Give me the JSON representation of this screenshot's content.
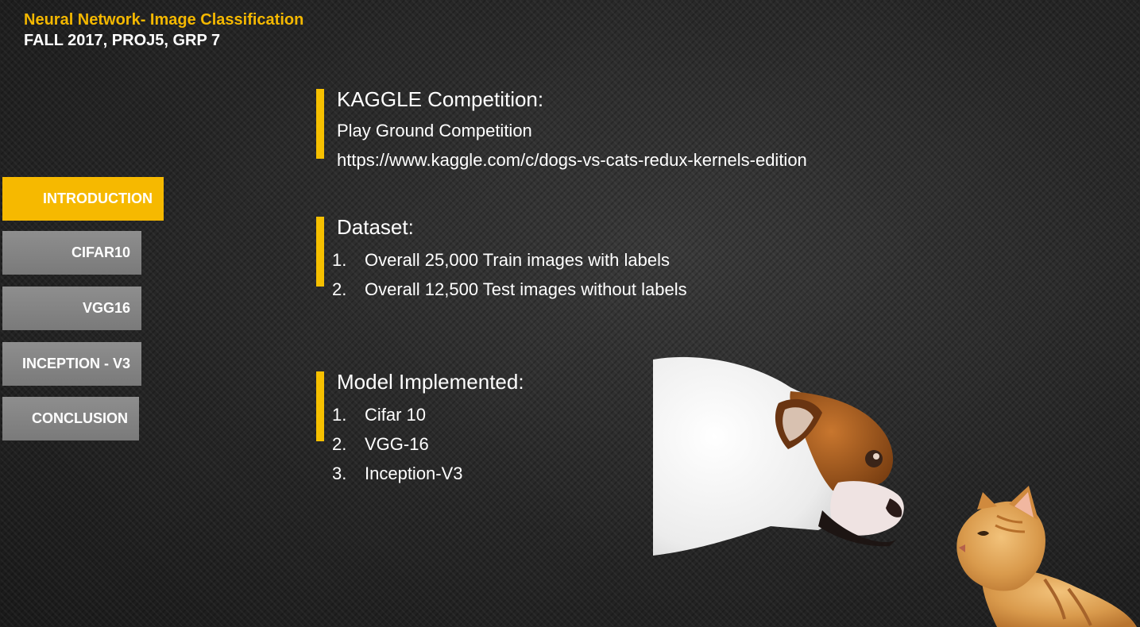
{
  "header": {
    "title": "Neural Network- Image Classification",
    "subtitle": "FALL 2017, PROJ5, GRP 7"
  },
  "nav": {
    "items": [
      {
        "label": "INTRODUCTION",
        "active": true
      },
      {
        "label": "CIFAR10",
        "active": false
      },
      {
        "label": "VGG16",
        "active": false
      },
      {
        "label": "INCEPTION - V3",
        "active": false
      },
      {
        "label": "CONCLUSION",
        "active": false
      }
    ]
  },
  "kaggle": {
    "heading": "KAGGLE Competition:",
    "line1": "Play Ground Competition",
    "line2": "https://www.kaggle.com/c/dogs-vs-cats-redux-kernels-edition"
  },
  "dataset": {
    "heading": "Dataset:",
    "items": [
      {
        "num": "1.",
        "text": "Overall 25,000 Train images with labels"
      },
      {
        "num": "2.",
        "text": "Overall 12,500 Test images without labels"
      }
    ]
  },
  "models": {
    "heading": "Model Implemented:",
    "items": [
      {
        "num": "1.",
        "text": "Cifar 10"
      },
      {
        "num": "2.",
        "text": "VGG-16"
      },
      {
        "num": "3.",
        "text": "Inception-V3"
      }
    ]
  },
  "colors": {
    "accent": "#f6b900",
    "nav_inactive": "#858585",
    "background": "#262626"
  },
  "images": {
    "dog": "bulldog-photo",
    "cat": "orange-cat-photo"
  }
}
